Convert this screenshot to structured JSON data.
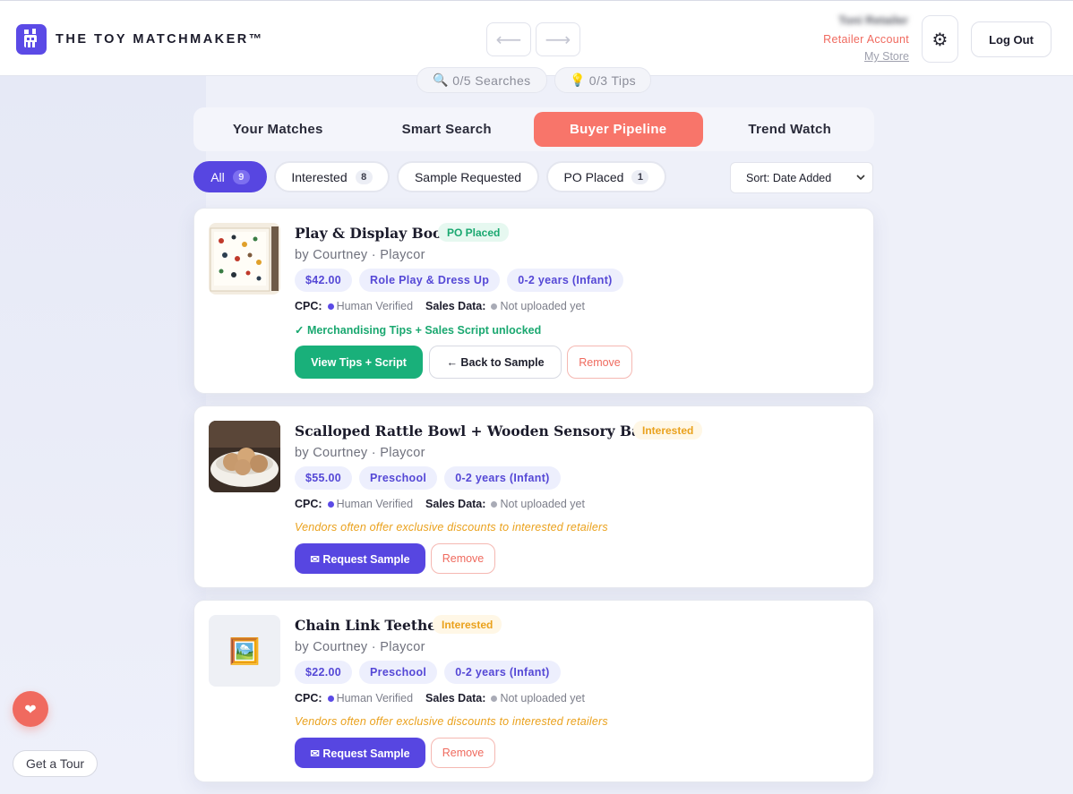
{
  "header": {
    "logo_text": "THE TOY MATCHMAKER™",
    "back_arrow": "⟵",
    "forward_arrow": "⟶",
    "user_name": "Toni Retailer",
    "account_type": "Retailer Account",
    "my_store": "My Store",
    "settings_icon": "⚙",
    "logout_label": "Log Out"
  },
  "counters": {
    "searches": "0/5 Searches",
    "searches_icon": "🔍",
    "tips": "0/3 Tips",
    "tips_icon": "💡"
  },
  "tabs": [
    {
      "label": "Your Matches"
    },
    {
      "label": "Smart Search"
    },
    {
      "label": "Buyer Pipeline"
    },
    {
      "label": "Trend Watch"
    }
  ],
  "filters": [
    {
      "label": "All",
      "count": "9"
    },
    {
      "label": "Interested",
      "count": "8"
    },
    {
      "label": "Sample Requested"
    },
    {
      "label": "PO Placed",
      "count": "1"
    }
  ],
  "sort": {
    "value": "Sort: Date Added"
  },
  "cards": [
    {
      "title": "Play & Display Book",
      "status": "PO Placed",
      "byline": "by Courtney · Playcor",
      "tags": [
        "$42.00",
        "Role Play & Dress Up",
        "0-2 years (Infant)"
      ],
      "cpc_label": "CPC:",
      "cpc_value": "Human Verified",
      "sales_label": "Sales Data:",
      "sales_value": "Not uploaded yet",
      "note": "✓ Merchandising Tips + Sales Script unlocked",
      "primary_button": "View Tips + Script",
      "secondary_button": "← Back to Sample",
      "remove_button": "Remove"
    },
    {
      "title": "Scalloped Rattle Bowl + Wooden Sensory Balls Set",
      "status": "Interested",
      "byline": "by Courtney · Playcor",
      "tags": [
        "$55.00",
        "Preschool",
        "0-2 years (Infant)"
      ],
      "cpc_label": "CPC:",
      "cpc_value": "Human Verified",
      "sales_label": "Sales Data:",
      "sales_value": "Not uploaded yet",
      "note": "Vendors often offer exclusive discounts to interested retailers",
      "primary_button": "✉ Request Sample",
      "remove_button": "Remove"
    },
    {
      "title": "Chain Link Teether",
      "status": "Interested",
      "byline": "by Courtney · Playcor",
      "tags": [
        "$22.00",
        "Preschool",
        "0-2 years (Infant)"
      ],
      "cpc_label": "CPC:",
      "cpc_value": "Human Verified",
      "sales_label": "Sales Data:",
      "sales_value": "Not uploaded yet",
      "note": "Vendors often offer exclusive discounts to interested retailers",
      "primary_button": "✉ Request Sample",
      "remove_button": "Remove",
      "placeholder_icon": "🖼️"
    }
  ],
  "floating": {
    "heart_icon": "❤",
    "tour_label": "Get a Tour"
  },
  "colors": {
    "brand_purple": "#5746e1",
    "accent_coral": "#f8756a",
    "success_green": "#19b07a",
    "warning_orange": "#eaa11c"
  }
}
